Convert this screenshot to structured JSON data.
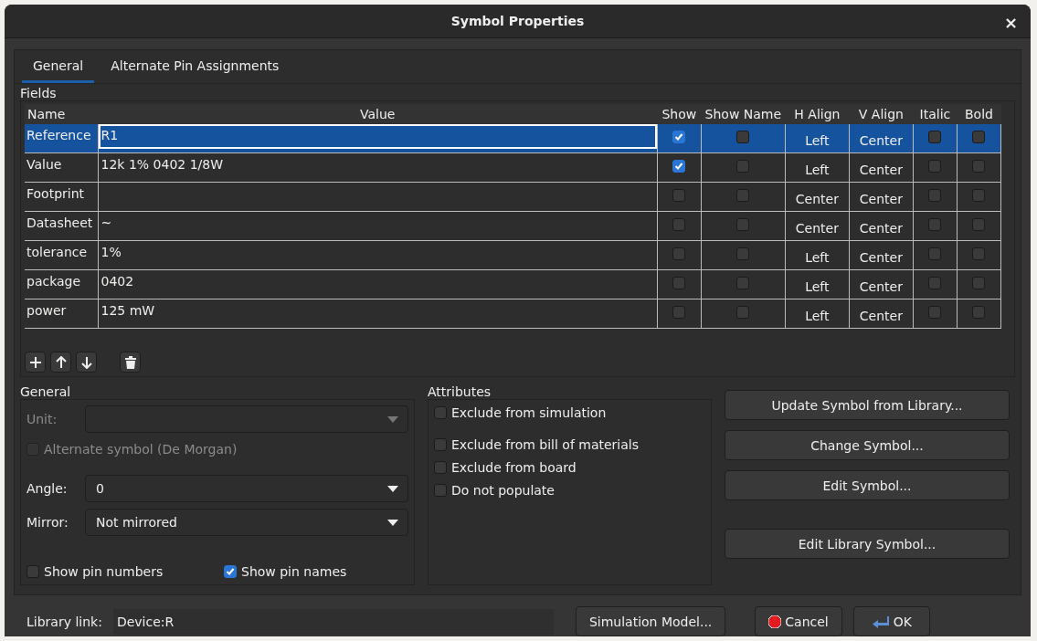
{
  "window": {
    "title": "Symbol Properties",
    "close": "×"
  },
  "tabs": [
    {
      "label": "General",
      "selected": true
    },
    {
      "label": "Alternate Pin Assignments",
      "selected": false
    }
  ],
  "fields": {
    "title": "Fields",
    "columns": [
      "Name",
      "Value",
      "Show",
      "Show Name",
      "H Align",
      "V Align",
      "Italic",
      "Bold"
    ],
    "rows": [
      {
        "name": "Reference",
        "value": "R1",
        "show": true,
        "show_name": false,
        "h_align": "Left",
        "v_align": "Center",
        "italic": false,
        "bold": false,
        "selected": true,
        "editing": true
      },
      {
        "name": "Value",
        "value": "12k 1% 0402 1/8W",
        "show": true,
        "show_name": false,
        "h_align": "Left",
        "v_align": "Center",
        "italic": false,
        "bold": false,
        "selected": false,
        "editing": false
      },
      {
        "name": "Footprint",
        "show": false,
        "show_name": false,
        "h_align": "Center",
        "v_align": "Center",
        "italic": false,
        "bold": false,
        "selected": false,
        "editing": false
      },
      {
        "name": "Datasheet",
        "value": "~",
        "show": false,
        "show_name": false,
        "h_align": "Center",
        "v_align": "Center",
        "italic": false,
        "bold": false,
        "selected": false,
        "editing": false
      },
      {
        "name": "tolerance",
        "value": "1%",
        "show": false,
        "show_name": false,
        "h_align": "Left",
        "v_align": "Center",
        "italic": false,
        "bold": false,
        "selected": false,
        "editing": false
      },
      {
        "name": "package",
        "value": "0402",
        "show": false,
        "show_name": false,
        "h_align": "Left",
        "v_align": "Center",
        "italic": false,
        "bold": false,
        "selected": false,
        "editing": false
      },
      {
        "name": "power",
        "value": "125 mW",
        "show": false,
        "show_name": false,
        "h_align": "Left",
        "v_align": "Center",
        "italic": false,
        "bold": false,
        "selected": false,
        "editing": false
      }
    ],
    "tools": [
      {
        "kind": "add"
      },
      {
        "kind": "up"
      },
      {
        "kind": "down"
      },
      {
        "kind": "delete"
      }
    ]
  },
  "general": {
    "title": "General",
    "unit": {
      "label": "Unit:",
      "disabled": true
    },
    "alternate": {
      "label": "Alternate symbol (De Morgan)",
      "checked": false,
      "disabled": true
    },
    "angle": {
      "label": "Angle:",
      "value": "0",
      "disabled": false
    },
    "mirror": {
      "label": "Mirror:",
      "value": "Not mirrored",
      "disabled": false
    },
    "show_pin_numbers": {
      "label": "Show pin numbers",
      "checked": false
    },
    "show_pin_names": {
      "label": "Show pin names",
      "checked": true
    }
  },
  "attributes": {
    "title": "Attributes",
    "items": [
      {
        "label": "Exclude from simulation",
        "checked": false
      },
      {
        "label": "Exclude from bill of materials",
        "checked": false
      },
      {
        "label": "Exclude from board",
        "checked": false
      },
      {
        "label": "Do not populate",
        "checked": false
      }
    ]
  },
  "side_buttons": [
    "Update Symbol from Library...",
    "Change Symbol...",
    "Edit Symbol...",
    "Edit Library Symbol..."
  ],
  "footer": {
    "library_label": "Library link:",
    "library_value": "Device:R",
    "simulation": "Simulation Model...",
    "cancel": "Cancel",
    "ok": "OK"
  }
}
